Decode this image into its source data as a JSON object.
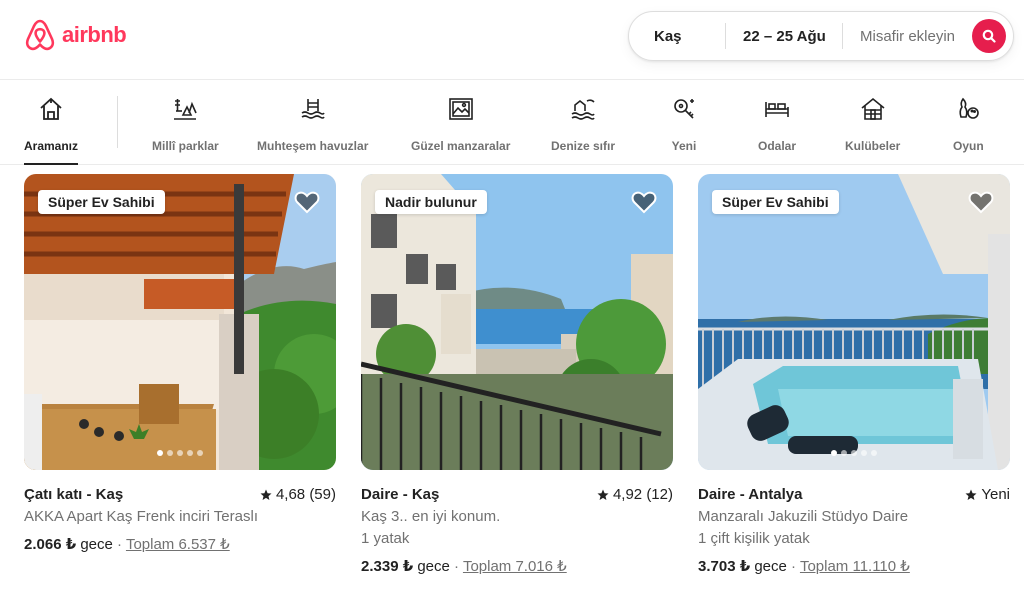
{
  "brand": {
    "name": "airbnb",
    "color": "#ff385c"
  },
  "search": {
    "location": "Kaş",
    "dates": "22 – 25 Ağu",
    "guests": "Misafir ekleyin",
    "button_icon": "search-icon"
  },
  "categories": [
    {
      "label": "Aramanız",
      "icon": "house-icon",
      "active": true
    },
    {
      "label": "Millî parklar",
      "icon": "park-icon"
    },
    {
      "label": "Muhteşem havuzlar",
      "icon": "pool-icon"
    },
    {
      "label": "Güzel manzaralar",
      "icon": "landscape-icon"
    },
    {
      "label": "Denize sıfır",
      "icon": "beachfront-icon"
    },
    {
      "label": "Yeni",
      "icon": "new-key-icon"
    },
    {
      "label": "Odalar",
      "icon": "bed-icon"
    },
    {
      "label": "Kulübeler",
      "icon": "cabin-icon"
    },
    {
      "label": "Oyun",
      "icon": "bowling-icon"
    }
  ],
  "listings": [
    {
      "badge": "Süper Ev Sahibi",
      "title": "Çatı katı - Kaş",
      "rating": "4,68 (59)",
      "line1": "AKKA Apart Kaş Frenk inciri Teraslı",
      "line2": "",
      "price": "2.066 ₺",
      "per": "gece",
      "sep": "·",
      "total": "Toplam 6.537 ₺"
    },
    {
      "badge": "Nadir bulunur",
      "title": "Daire - Kaş",
      "rating": "4,92 (12)",
      "line1": "Kaş 3.. en iyi konum.",
      "line2": "1 yatak",
      "price": "2.339 ₺",
      "per": "gece",
      "sep": "·",
      "total": "Toplam 7.016 ₺"
    },
    {
      "badge": "Süper Ev Sahibi",
      "title": "Daire - Antalya",
      "rating": "Yeni",
      "line1": "Manzaralı Jakuzili Stüdyo Daire",
      "line2": "1 çift kişilik yatak",
      "price": "3.703 ₺",
      "per": "gece",
      "sep": "·",
      "total": "Toplam 11.110 ₺"
    }
  ]
}
